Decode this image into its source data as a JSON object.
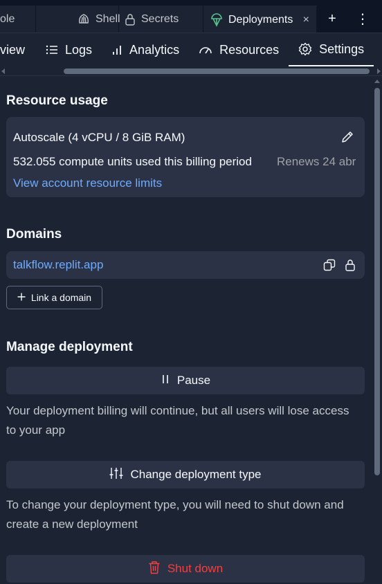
{
  "tabs": {
    "partial_label": "ole",
    "shell_label": "Shell",
    "secrets_label": "Secrets",
    "deployments_label": "Deployments",
    "close_glyph": "×",
    "plus_glyph": "+",
    "more_glyph": "⋮"
  },
  "subnav": {
    "partial_label": "view",
    "logs_label": "Logs",
    "analytics_label": "Analytics",
    "resources_label": "Resources",
    "settings_label": "Settings"
  },
  "resource_usage": {
    "heading": "Resource usage",
    "plan": "Autoscale (4 vCPU / 8 GiB RAM)",
    "usage": "532.055 compute units used this billing period",
    "renews": "Renews 24 abr",
    "limits_link": "View account resource limits"
  },
  "domains": {
    "heading": "Domains",
    "domain": "talkflow.replit.app",
    "link_button": "Link a domain"
  },
  "manage": {
    "heading": "Manage deployment",
    "pause_label": "Pause",
    "pause_desc": "Your deployment billing will continue, but all users will lose access to your app",
    "change_label": "Change deployment type",
    "change_desc": "To change your deployment type, you will need to shut down and create a new deployment",
    "shutdown_label": "Shut down"
  },
  "colors": {
    "background": "#1c2333",
    "surface": "#2b3245",
    "link": "#6dabff",
    "danger": "#f23f3f",
    "deploy_icon": "#58c38e"
  }
}
